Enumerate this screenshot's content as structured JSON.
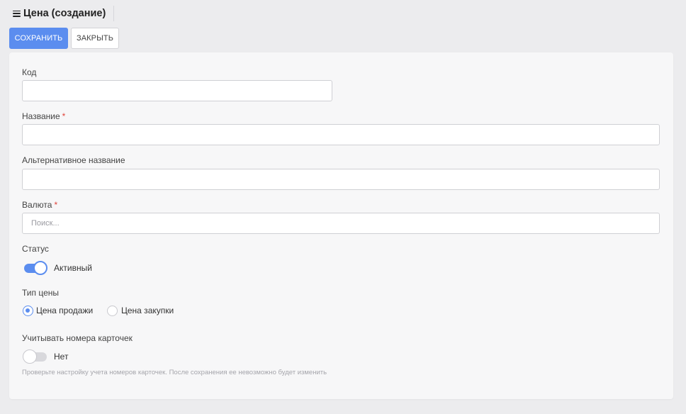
{
  "header": {
    "title": "Цена (создание)"
  },
  "toolbar": {
    "save_label": "СОХРАНИТЬ",
    "close_label": "ЗАКРЫТЬ"
  },
  "form": {
    "code": {
      "label": "Код",
      "value": ""
    },
    "name": {
      "label": "Название",
      "required_mark": "*",
      "value": ""
    },
    "alt_name": {
      "label": "Альтернативное название",
      "value": ""
    },
    "currency": {
      "label": "Валюта",
      "required_mark": "*",
      "placeholder": "Поиск...",
      "value": ""
    },
    "status": {
      "label": "Статус",
      "state": "on",
      "state_label": "Активный"
    },
    "price_type": {
      "label": "Тип цены",
      "options": [
        {
          "label": "Цена продажи",
          "selected": true
        },
        {
          "label": "Цена закупки",
          "selected": false
        }
      ]
    },
    "card_numbers": {
      "label": "Учитывать номера карточек",
      "state": "off",
      "state_label": "Нет",
      "hint": "Проверьте настройку учета номеров карточек. После сохранения ее невозможно будет изменить"
    }
  },
  "colors": {
    "accent": "#5b8def",
    "required": "#e0443b",
    "background": "#ececee",
    "card": "#f7f7f8"
  }
}
